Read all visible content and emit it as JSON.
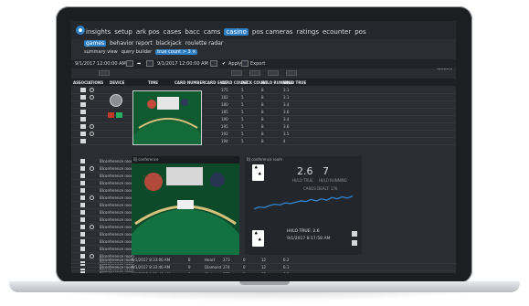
{
  "nav": {
    "items": [
      "insights",
      "setup",
      "ark pos",
      "cases",
      "bacc",
      "cams",
      "casino",
      "pos cameras",
      "ratings",
      "ecounter",
      "pos"
    ],
    "active": "casino"
  },
  "subnav": {
    "items": [
      "games",
      "behavior report",
      "blackjack",
      "roulette radar"
    ],
    "active": "games"
  },
  "subnav2": {
    "summary_view": "summary view",
    "query_builder": "query builder",
    "badge": "true count > 3 ×"
  },
  "filter": {
    "start": "9/1/2017 12:00:00 AM",
    "end": "9/1/2017 12:00:00 AM",
    "apply": "Apply",
    "export": "Export"
  },
  "topright": [
    "ADDED",
    "RESULTS"
  ],
  "table": {
    "headers": [
      "ASSOCIATIONS",
      "DEVICE",
      "TIME",
      "CARD NUMBER",
      "CARD SUIT",
      "CARD COUNT",
      "DECK COUNT",
      "HI/LO RUNNING",
      "HI/LO TRUE"
    ],
    "rows": [
      [
        "175",
        "5",
        "8",
        "3.1"
      ],
      [
        "182",
        "5",
        "8",
        "3.1"
      ],
      [
        "180",
        "5",
        "8",
        "3.4"
      ],
      [
        "185",
        "5",
        "8",
        "3.6"
      ],
      [
        "190",
        "5",
        "8",
        "3.4"
      ],
      [
        "195",
        "5",
        "8",
        "3.6"
      ],
      [
        "192",
        "5",
        "8",
        "3.5"
      ],
      [
        "194",
        "5",
        "8",
        "4"
      ]
    ]
  },
  "left_rows": [
    "Blconference room",
    "Blconference room",
    "Blconference room",
    "Blconference room",
    "Blconference room",
    "Blconference room",
    "Blconference room",
    "Blconference room",
    "Blconference room",
    "Blconference room",
    "Blconference room",
    "Blconference room",
    "Blconference room",
    "Blconference room",
    "Blconference room",
    "Blconference room"
  ],
  "panel_left": {
    "header": "BJ conference"
  },
  "panel_right": {
    "header": "BJ conference room",
    "stat_true": "2.6",
    "stat_running": "7",
    "label_true": "HI/LO TRUE",
    "label_running": "HI/LO RUNNING",
    "cards_dealt": "CARDS DEALT: 176",
    "hilo_label": "HI/LO TRUE:",
    "hilo_value": "2.6",
    "hilo_time": "9/1/2017 8:17:58 AM"
  },
  "bottom_rows": [
    [
      "Blconference room",
      "9/1/2017 8:33:06 AM",
      "8",
      "Heart",
      "273",
      "0",
      "12",
      "6.2"
    ],
    [
      "Blconference room",
      "9/1/2017 8:33:46 AM",
      "9",
      "Diamond",
      "274",
      "0",
      "12",
      "6.1"
    ],
    [
      "Blconference room",
      "9/1/2017 8:33:46 AM",
      "8",
      "Club",
      "275",
      "0",
      "12",
      "6.2"
    ]
  ],
  "chart_data": {
    "type": "line",
    "x": [
      1,
      2,
      3,
      4,
      5,
      6,
      7,
      8,
      9,
      10,
      11,
      12,
      13,
      14,
      15,
      16,
      17,
      18,
      19,
      20
    ],
    "series": [
      {
        "values": [
          1.1,
          1.4,
          1.3,
          1.6,
          1.8,
          1.7,
          2.0,
          1.9,
          2.1,
          2.3,
          2.2,
          2.5,
          2.3,
          2.6,
          2.4,
          2.8,
          2.6,
          2.9,
          2.7,
          3.0
        ]
      }
    ],
    "ylim": [
      0,
      3.5
    ],
    "grid": false,
    "color": "#2f7fc6"
  },
  "colors": {
    "accent": "#2f7fc6",
    "bg": "#2a2d31",
    "felt": "#0d4a2a"
  }
}
